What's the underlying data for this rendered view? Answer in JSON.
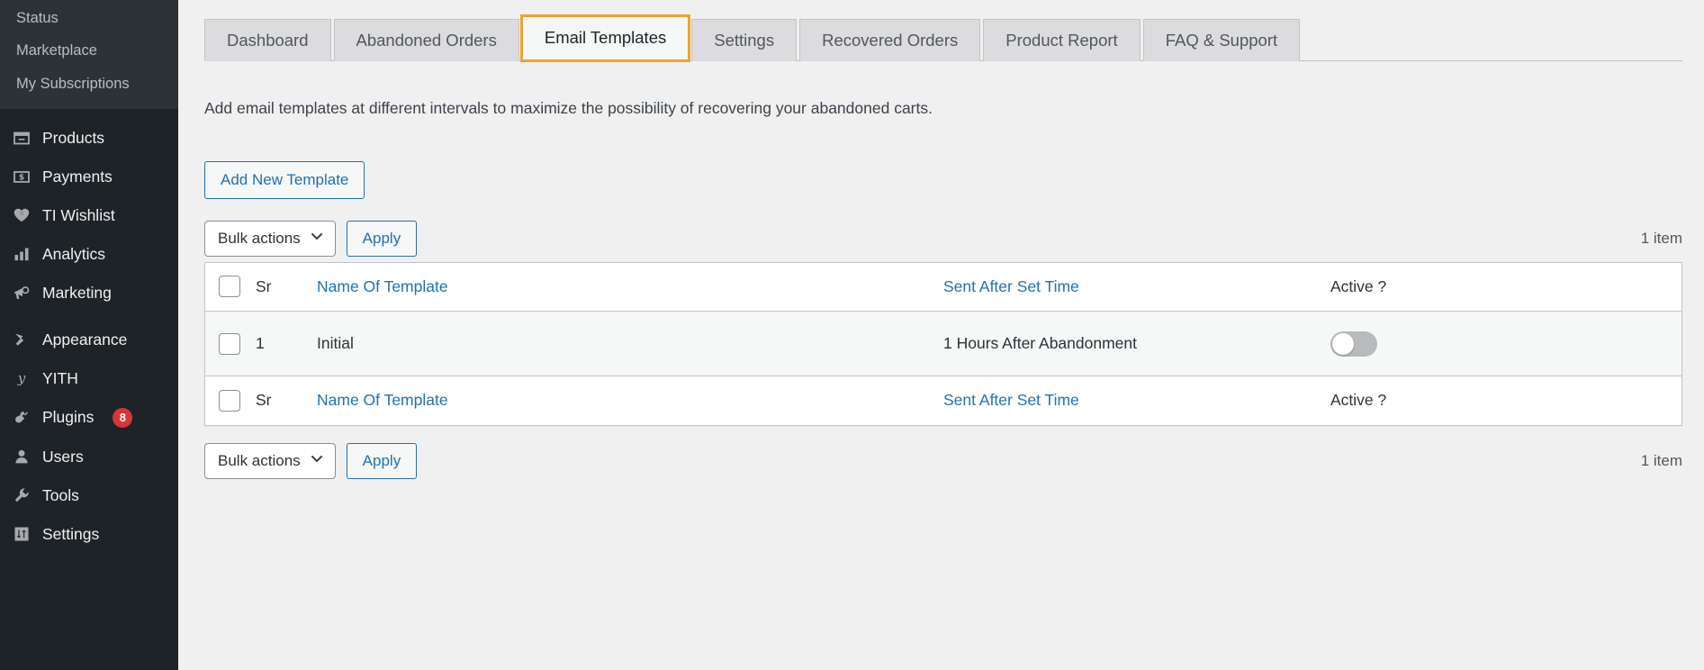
{
  "sidebar": {
    "submenu": [
      {
        "label": "Status",
        "name": "sidebar-subitem-status"
      },
      {
        "label": "Marketplace",
        "name": "sidebar-subitem-marketplace"
      },
      {
        "label": "My Subscriptions",
        "name": "sidebar-subitem-my-subscriptions"
      }
    ],
    "menu": [
      {
        "label": "Products",
        "icon": "products-icon",
        "name": "sidebar-item-products",
        "badge": ""
      },
      {
        "label": "Payments",
        "icon": "payments-icon",
        "name": "sidebar-item-payments",
        "badge": ""
      },
      {
        "label": "TI Wishlist",
        "icon": "wishlist-heart-icon",
        "name": "sidebar-item-ti-wishlist",
        "badge": ""
      },
      {
        "label": "Analytics",
        "icon": "analytics-bars-icon",
        "name": "sidebar-item-analytics",
        "badge": ""
      },
      {
        "label": "Marketing",
        "icon": "marketing-megaphone-icon",
        "name": "sidebar-item-marketing",
        "badge": ""
      },
      {
        "label": "Appearance",
        "icon": "appearance-brush-icon",
        "name": "sidebar-item-appearance",
        "badge": ""
      },
      {
        "label": "YITH",
        "icon": "yith-logo-icon",
        "name": "sidebar-item-yith",
        "badge": ""
      },
      {
        "label": "Plugins",
        "icon": "plugins-plug-icon",
        "name": "sidebar-item-plugins",
        "badge": "8"
      },
      {
        "label": "Users",
        "icon": "users-person-icon",
        "name": "sidebar-item-users",
        "badge": ""
      },
      {
        "label": "Tools",
        "icon": "tools-wrench-icon",
        "name": "sidebar-item-tools",
        "badge": ""
      },
      {
        "label": "Settings",
        "icon": "settings-sliders-icon",
        "name": "sidebar-item-settings",
        "badge": ""
      }
    ],
    "colors": {
      "background": "#1d2327",
      "submenu_background": "#2c3338",
      "badge": "#d63638"
    }
  },
  "tabs": [
    {
      "label": "Dashboard",
      "active": false
    },
    {
      "label": "Abandoned Orders",
      "active": false
    },
    {
      "label": "Email Templates",
      "active": true
    },
    {
      "label": "Settings",
      "active": false
    },
    {
      "label": "Recovered Orders",
      "active": false
    },
    {
      "label": "Product Report",
      "active": false
    },
    {
      "label": "FAQ & Support",
      "active": false
    }
  ],
  "page": {
    "description": "Add email templates at different intervals to maximize the possibility of recovering your abandoned carts.",
    "add_new_template_label": "Add New Template",
    "focus_outline_color": "#f0a32a",
    "link_color": "#2271b1"
  },
  "tablenav_top": {
    "bulk_actions_label": "Bulk actions",
    "apply_label": "Apply",
    "item_count": "1 item"
  },
  "tablenav_bottom": {
    "bulk_actions_label": "Bulk actions",
    "apply_label": "Apply",
    "item_count": "1 item"
  },
  "table": {
    "columns": {
      "sr": "Sr",
      "name": "Name Of Template",
      "time": "Sent After Set Time",
      "active": "Active ?"
    },
    "rows": [
      {
        "sr": "1",
        "name": "Initial",
        "time": "1 Hours After Abandonment",
        "active": false
      }
    ]
  }
}
